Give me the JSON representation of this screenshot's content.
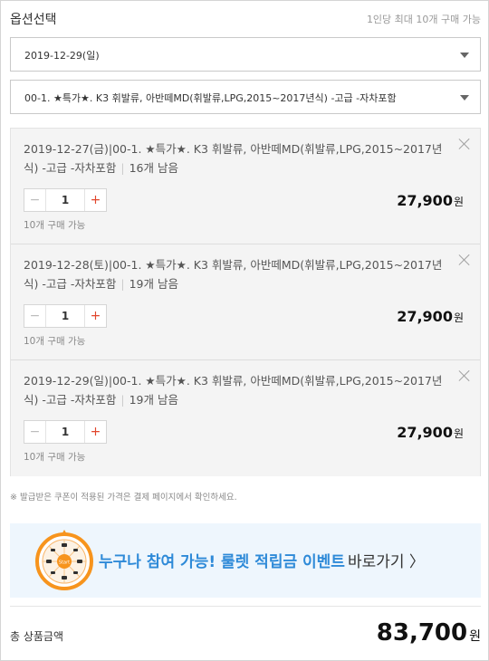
{
  "header": {
    "title": "옵션선택",
    "limit": "1인당 최대 10개 구매 가능"
  },
  "select_date": {
    "value": "2019-12-29(일)"
  },
  "select_option": {
    "value": "00-1. ★특가★. K3 휘발류, 아반떼MD(휘발류,LPG,2015~2017년식) -고급 -자차포함"
  },
  "items": [
    {
      "name": "2019-12-27(금)|00-1. ★특가★. K3 휘발류, 아반떼MD(휘발류,LPG,2015~2017년식) -고급 -자차포함",
      "remaining": "16개 남음",
      "qty": "1",
      "price": "27,900",
      "won": "원",
      "avail": "10개 구매 가능"
    },
    {
      "name": "2019-12-28(토)|00-1. ★특가★. K3 휘발류, 아반떼MD(휘발류,LPG,2015~2017년식) -고급 -자차포함",
      "remaining": "19개 남음",
      "qty": "1",
      "price": "27,900",
      "won": "원",
      "avail": "10개 구매 가능"
    },
    {
      "name": "2019-12-29(일)|00-1. ★특가★. K3 휘발류, 아반떼MD(휘발류,LPG,2015~2017년식) -고급 -자차포함",
      "remaining": "19개 남음",
      "qty": "1",
      "price": "27,900",
      "won": "원",
      "avail": "10개 구매 가능"
    }
  ],
  "stepper": {
    "minus": "−",
    "plus": "+"
  },
  "notice": "※ 발급받은 쿠폰이 적용된 가격은 결제 페이지에서 확인하세요.",
  "banner": {
    "text": "누구나 참여 가능! 룰렛 적립금 이벤트",
    "go": "바로가기 〉",
    "wheel_label": "Start"
  },
  "total": {
    "label": "총 상품금액",
    "amount": "83,700",
    "won": "원"
  },
  "colors": {
    "accent": "#e1462c",
    "banner_text": "#2e8ad8",
    "banner_bg": "#eef6fd",
    "wheel": "#f7941d"
  }
}
